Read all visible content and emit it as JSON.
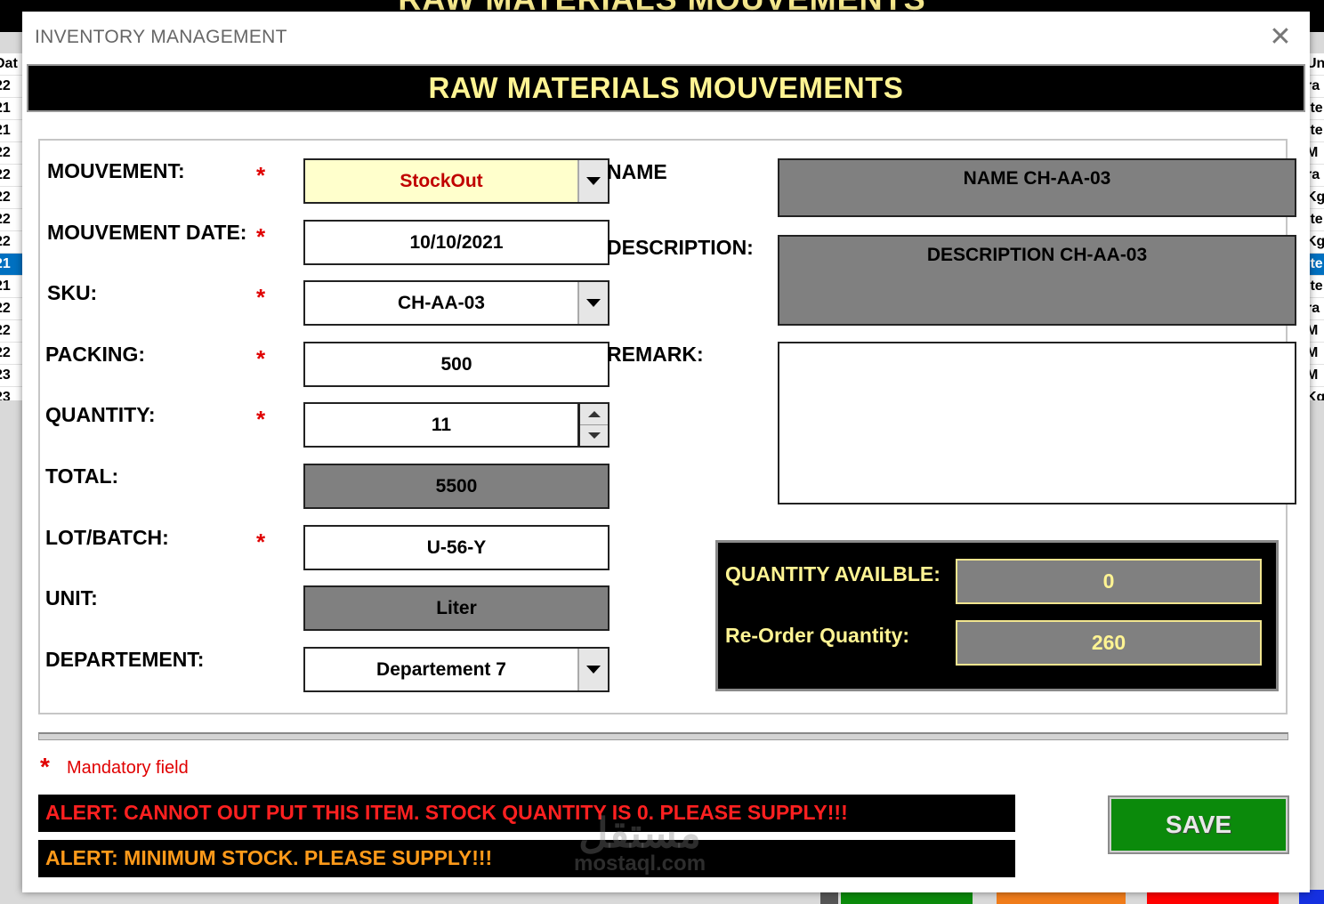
{
  "background": {
    "banner_title": "RAW MATERIALS MOUVEMENTS",
    "left_column": [
      "Dat",
      "22",
      "21",
      "21",
      "22",
      "22",
      "22",
      "22",
      "22",
      "21",
      "21",
      "22",
      "22",
      "22",
      "23",
      "23"
    ],
    "right_column": [
      "Un",
      "ra",
      "ite",
      "ite",
      "M",
      "ra",
      "Kg",
      "ite",
      "Kg",
      "ite",
      "ite",
      "ra",
      "M",
      "M",
      "M",
      "Kg"
    ]
  },
  "window": {
    "title": "INVENTORY MANAGEMENT",
    "close_glyph": "✕"
  },
  "header": {
    "title": "RAW MATERIALS MOUVEMENTS"
  },
  "form": {
    "mouvement": {
      "label": "MOUVEMENT:",
      "value": "StockOut"
    },
    "mouvement_date": {
      "label": "MOUVEMENT DATE:",
      "value": "10/10/2021"
    },
    "sku": {
      "label": "SKU:",
      "value": "CH-AA-03"
    },
    "packing": {
      "label": "PACKING:",
      "value": "500"
    },
    "quantity": {
      "label": "QUANTITY:",
      "value": "11"
    },
    "total": {
      "label": "TOTAL:",
      "value": "5500"
    },
    "lot_batch": {
      "label": "LOT/BATCH:",
      "value": "U-56-Y"
    },
    "unit": {
      "label": "UNIT:",
      "value": "Liter"
    },
    "departement": {
      "label": "DEPARTEMENT:",
      "value": "Departement 7"
    },
    "name": {
      "label": "NAME",
      "value": "NAME CH-AA-03"
    },
    "description": {
      "label": "DESCRIPTION:",
      "value": "DESCRIPTION CH-AA-03"
    },
    "remark": {
      "label": "REMARK:",
      "value": ""
    },
    "required_mark": "*"
  },
  "stock": {
    "available_label": "QUANTITY AVAILBLE:",
    "available_value": "0",
    "reorder_label": "Re-Order Quantity:",
    "reorder_value": "260"
  },
  "footer": {
    "mandatory_star": "*",
    "mandatory_text": "Mandatory field",
    "alert_stock_zero": "ALERT: CANNOT OUT PUT THIS ITEM. STOCK QUANTITY IS 0. PLEASE SUPPLY!!!",
    "alert_minimum": "ALERT: MINIMUM STOCK. PLEASE SUPPLY!!!",
    "save_label": "SAVE"
  },
  "watermark": {
    "arabic": "مستقل",
    "latin": "mostaql.com"
  },
  "colors": {
    "header_text": "#fff493",
    "required": "#e00000",
    "save_button": "#0b8a0b",
    "alert_red": "#ff2020",
    "alert_orange": "#ff9a1a",
    "readonly_field": "#808080",
    "movement_field": "#ffffcc"
  }
}
